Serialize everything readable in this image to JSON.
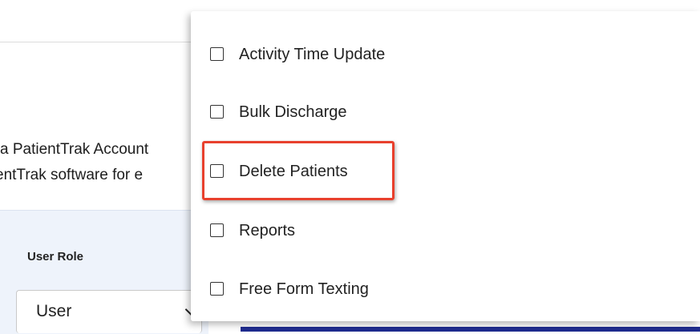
{
  "background": {
    "text_line1": "a PatientTrak Account",
    "text_line2": "entTrak software for e",
    "role_label": "User Role",
    "role_value": "User"
  },
  "dropdown": {
    "items": [
      {
        "label": "Activity Time Update",
        "checked": false
      },
      {
        "label": "Bulk Discharge",
        "checked": false
      },
      {
        "label": "Delete Patients",
        "checked": false,
        "highlighted": true
      },
      {
        "label": "Reports",
        "checked": false
      },
      {
        "label": "Free Form Texting",
        "checked": false
      }
    ]
  },
  "colors": {
    "highlight": "#e8402d",
    "accent_line": "#1f2c8f",
    "panel_bg": "#eef3fb"
  },
  "icons": {
    "chevron": "chevron-down-icon",
    "checkbox": "checkbox-empty-icon"
  }
}
